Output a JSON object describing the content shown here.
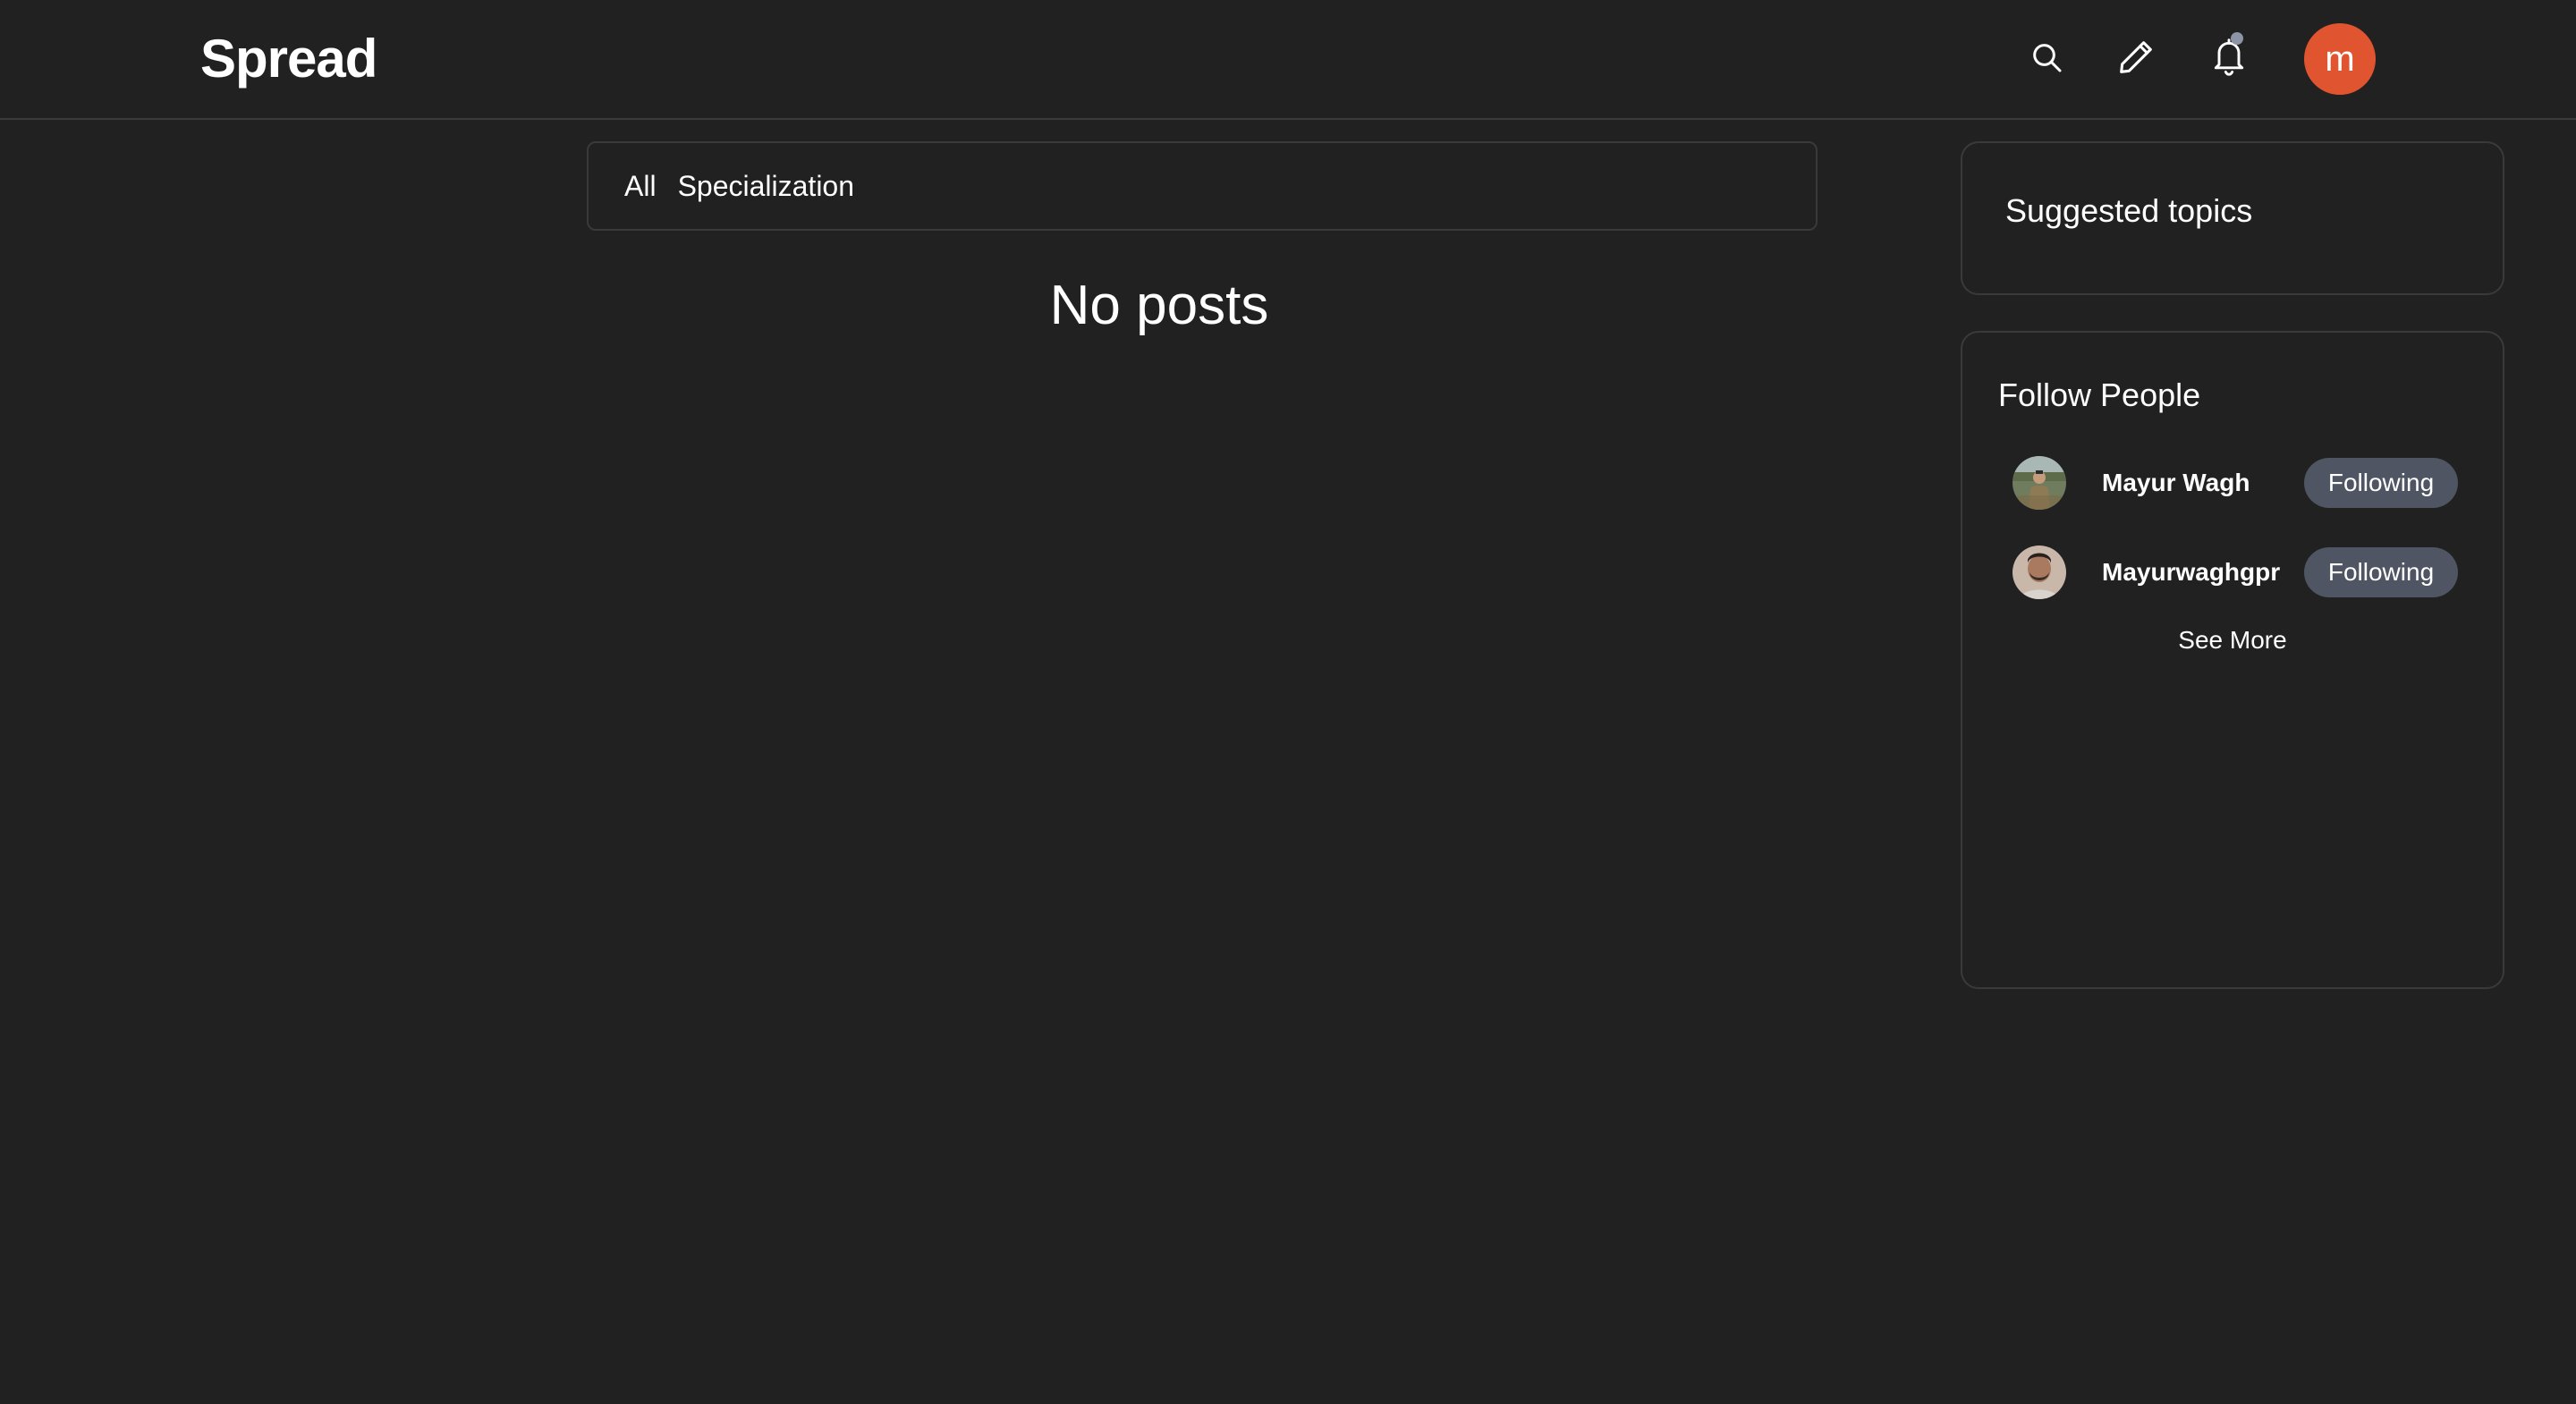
{
  "header": {
    "logo": "Spread",
    "user_initial": "m",
    "accent_color": "#e0552f",
    "icons": [
      "search-icon",
      "pencil-icon",
      "bell-icon"
    ]
  },
  "feed": {
    "tabs": [
      {
        "label": "All"
      },
      {
        "label": "Specialization"
      }
    ],
    "empty_message": "No posts"
  },
  "sidebar": {
    "suggested_topics_title": "Suggested topics",
    "follow_title": "Follow People",
    "people": [
      {
        "name": "Mayur Wagh",
        "button_label": "Following"
      },
      {
        "name": "Mayurwaghgpr",
        "button_label": "Following"
      }
    ],
    "see_more_label": "See More"
  }
}
